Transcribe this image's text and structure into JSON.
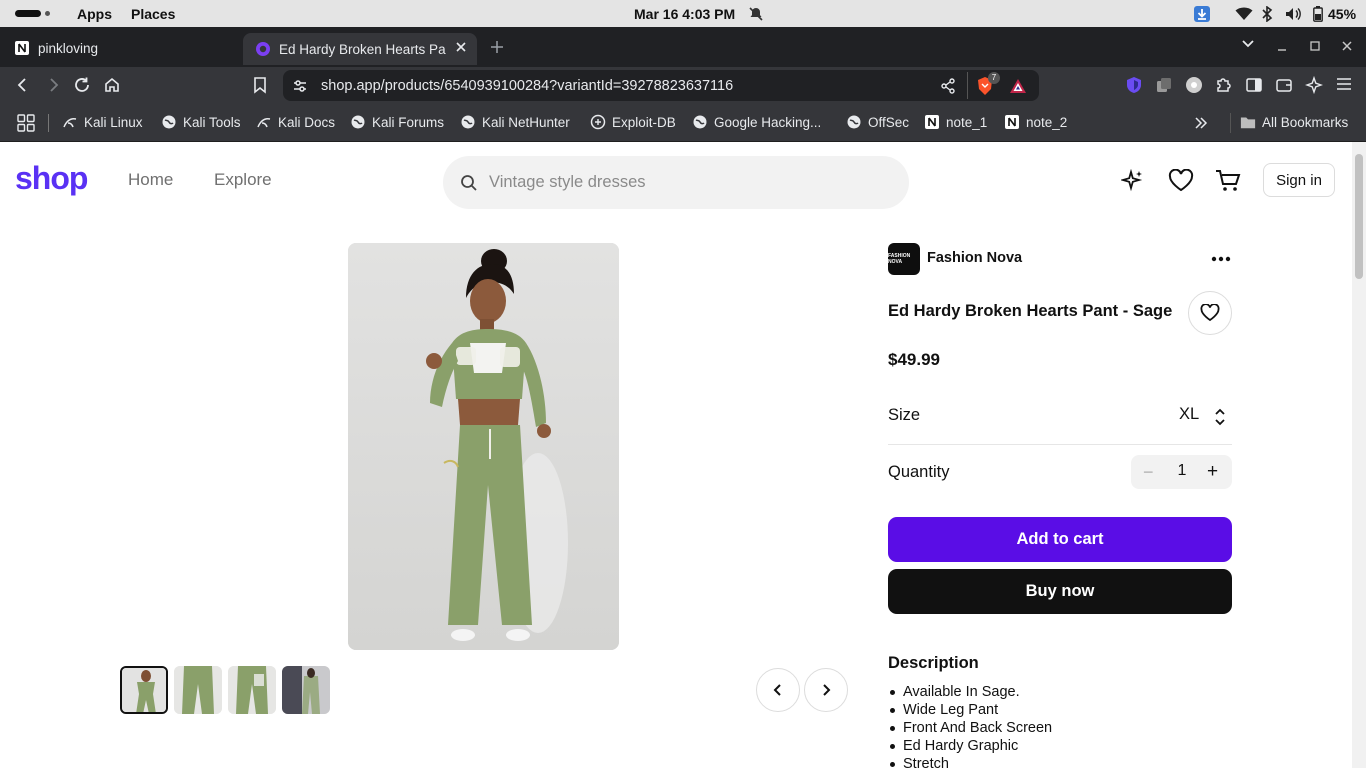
{
  "topbar": {
    "apps_label": "Apps",
    "places_label": "Places",
    "datetime": "Mar 16  4:03 PM",
    "battery": "45%"
  },
  "browser": {
    "tabs": [
      {
        "title": "pinkloving",
        "active": false
      },
      {
        "title": "Ed Hardy Broken Hearts Pa",
        "active": true
      }
    ],
    "url": "shop.app/products/6540939100284?variantId=39278823637116",
    "extension_badge": "7",
    "bookmarks": [
      {
        "label": "Kali Linux"
      },
      {
        "label": "Kali Tools"
      },
      {
        "label": "Kali Docs"
      },
      {
        "label": "Kali Forums"
      },
      {
        "label": "Kali NetHunter"
      },
      {
        "label": "Exploit-DB"
      },
      {
        "label": "Google Hacking..."
      },
      {
        "label": "OffSec"
      },
      {
        "label": "note_1"
      },
      {
        "label": "note_2"
      }
    ],
    "all_bookmarks_label": "All Bookmarks"
  },
  "site": {
    "logo": "shop",
    "nav": [
      "Home",
      "Explore"
    ],
    "search_placeholder": "Vintage style dresses",
    "sign_in_label": "Sign in",
    "brand_color": "#5a31f4"
  },
  "product": {
    "store_name": "Fashion Nova",
    "store_logo_text": "FASHION NOVA",
    "title": "Ed Hardy Broken Hearts Pant - Sage",
    "price": "$49.99",
    "size_label": "Size",
    "size_value": "XL",
    "quantity_label": "Quantity",
    "quantity_value": "1",
    "add_to_cart_label": "Add to cart",
    "buy_now_label": "Buy now",
    "add_to_cart_color": "#5a0de6",
    "description_heading": "Description",
    "description_items": [
      "Available In Sage.",
      "Wide Leg Pant",
      "Front And Back Screen",
      "Ed Hardy Graphic",
      "Stretch"
    ],
    "thumbnail_count": 4,
    "selected_thumbnail": 1,
    "garment_color": "#8aa06a"
  }
}
